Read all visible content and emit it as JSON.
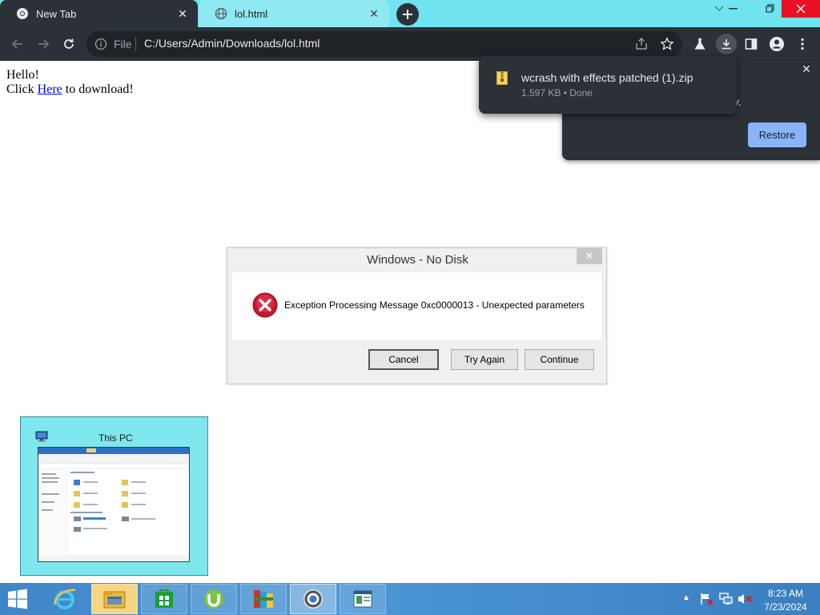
{
  "browser": {
    "tabs": [
      {
        "title": "New Tab",
        "close": "✕"
      },
      {
        "title": "lol.html",
        "close": "✕"
      }
    ],
    "omnibox": {
      "scheme_label": "File",
      "url": "C:/Users/Admin/Downloads/lol.html"
    }
  },
  "page": {
    "line1": "Hello!",
    "line2_prefix": "Click ",
    "link_text": "Here",
    "line2_suffix": " to download!"
  },
  "restore_bubble": {
    "message_fragment": "ctly.",
    "restore_label": "Restore",
    "close": "✕"
  },
  "download_bubble": {
    "filename": "wcrash with effects patched (1).zip",
    "meta": "1,597 KB • Done"
  },
  "dialog": {
    "title": "Windows - No Disk",
    "close": "✕",
    "message": "Exception Processing Message 0xc0000013 - Unexpected parameters",
    "buttons": {
      "cancel": "Cancel",
      "try_again": "Try Again",
      "continue": "Continue"
    }
  },
  "taskbar": {
    "thumbnail_title": "This PC",
    "apps": [
      "internet-explorer",
      "file-explorer",
      "windows-store",
      "utorrent",
      "winrar",
      "chrome",
      "reader"
    ],
    "clock": {
      "time": "8:23 AM",
      "date": "7/23/2024"
    }
  },
  "colors": {
    "tab_strip": "#6fe3ee",
    "toolbar": "#2b3137",
    "restore_button": "#8ab4f8",
    "close_red": "#e81123",
    "taskbar": "#4d98d6"
  }
}
